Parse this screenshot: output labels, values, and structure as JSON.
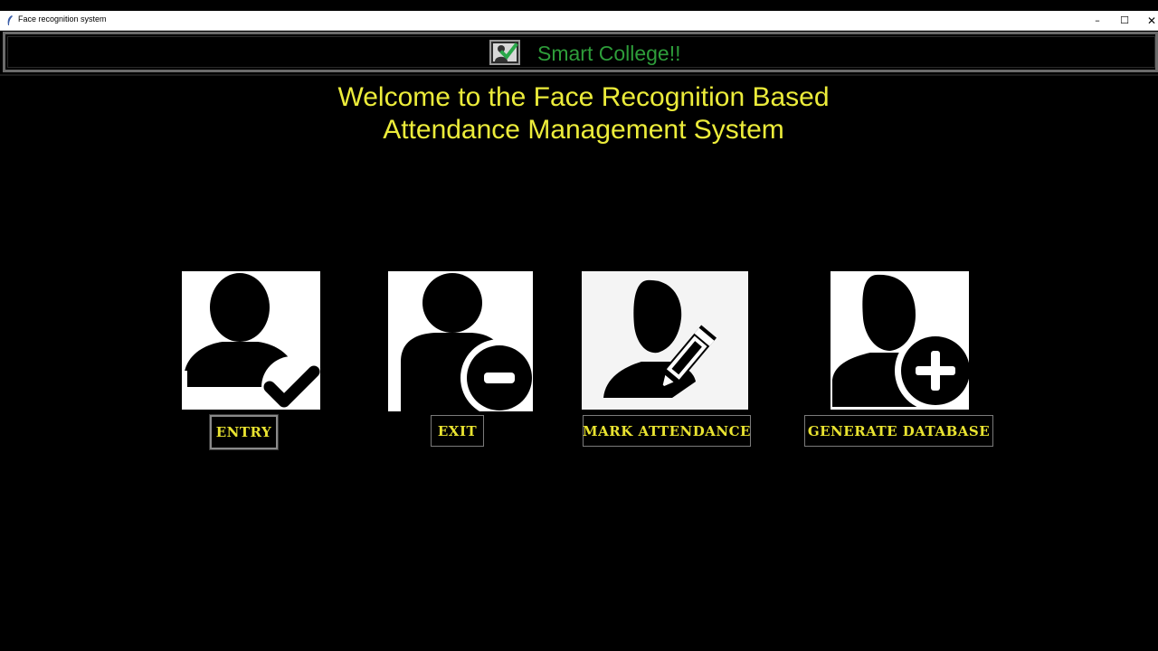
{
  "window": {
    "title": "Face recognition system",
    "minimize_glyph": "–",
    "maximize_glyph": "☐",
    "close_glyph": "✕"
  },
  "header": {
    "title": "Smart College!!",
    "logo_icon": "checkmark-board-icon",
    "title_color": "#2e9d3a"
  },
  "welcome": {
    "line1": "Welcome to the Face Recognition Based",
    "line2": "Attendance Management System",
    "color": "#ecec3a"
  },
  "actions": [
    {
      "label": "ENTRY",
      "icon": "user-check-icon"
    },
    {
      "label": "EXIT",
      "icon": "user-minus-icon"
    },
    {
      "label": "MARK ATTENDANCE",
      "icon": "user-edit-icon"
    },
    {
      "label": "GENERATE DATABASE",
      "icon": "user-add-icon"
    }
  ],
  "colors": {
    "background": "#000000",
    "button_text": "#e9e330"
  }
}
